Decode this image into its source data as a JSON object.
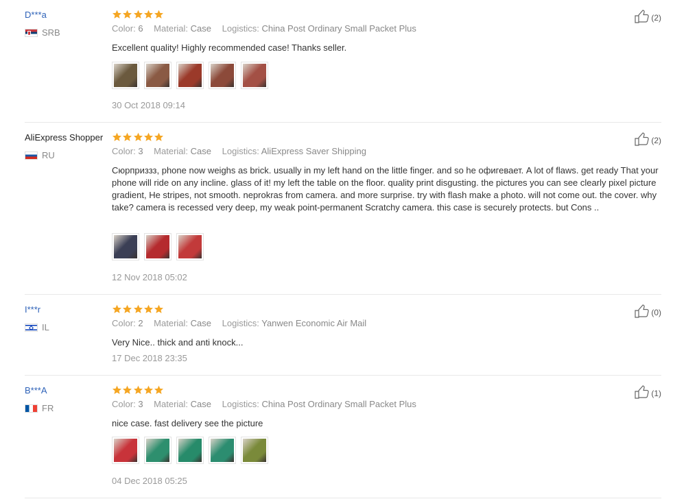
{
  "labels": {
    "color": "Color:",
    "material": "Material:",
    "logistics": "Logistics:"
  },
  "reviews": [
    {
      "user": "D***a",
      "country": "SRB",
      "color": "6",
      "material": "Case",
      "logistics": "China Post Ordinary Small Packet Plus",
      "text": "Excellent quality! Highly recommended case! Thanks seller.",
      "date": "30 Oct 2018 09:14",
      "likes": "(2)",
      "rating": 5,
      "photos": [
        "#6b5a3e",
        "#8a5a44",
        "#9b3a2a",
        "#8c4a3a",
        "#a35045"
      ]
    },
    {
      "user": "AliExpress Shopper",
      "country": "RU",
      "color": "3",
      "material": "Case",
      "logistics": "AliExpress Saver Shipping",
      "text": "Сюрприззз, phone now weighs as brick. usually in my left hand on the little finger. and so he офигевает. A lot of flaws. get ready That your phone will ride on any incline. glass of it! my left the table on the floor. quality print disgusting. the pictures you can see clearly pixel picture gradient, He stripes, not smooth. neprokras from camera. and more surprise. try with flash make a photo. will not come out. the cover. why take? camera is recessed very deep, my weak point-permanent Scratchy camera. this case is securely protects. but Cons ..",
      "date": "12 Nov 2018 05:02",
      "likes": "(2)",
      "rating": 5,
      "photos": [
        "#3b3f55",
        "#b52b2e",
        "#c23a3a"
      ]
    },
    {
      "user": "I***r",
      "country": "IL",
      "color": "2",
      "material": "Case",
      "logistics": "Yanwen Economic Air Mail",
      "text": "Very Nice.. thick and anti knock...",
      "date": "17 Dec 2018 23:35",
      "likes": "(0)",
      "rating": 5,
      "photos": []
    },
    {
      "user": "B***A",
      "country": "FR",
      "color": "3",
      "material": "Case",
      "logistics": "China Post Ordinary Small Packet Plus",
      "text": "nice case. fast delivery see the picture",
      "date": "04 Dec 2018 05:25",
      "likes": "(1)",
      "rating": 5,
      "photos": [
        "#c8333a",
        "#2e8f6e",
        "#278b6a",
        "#2c8d70",
        "#7a8a3a"
      ]
    }
  ],
  "colors": {
    "link": "#2e62b8",
    "star": "#f5a623",
    "separator": "#e8e8e8"
  }
}
